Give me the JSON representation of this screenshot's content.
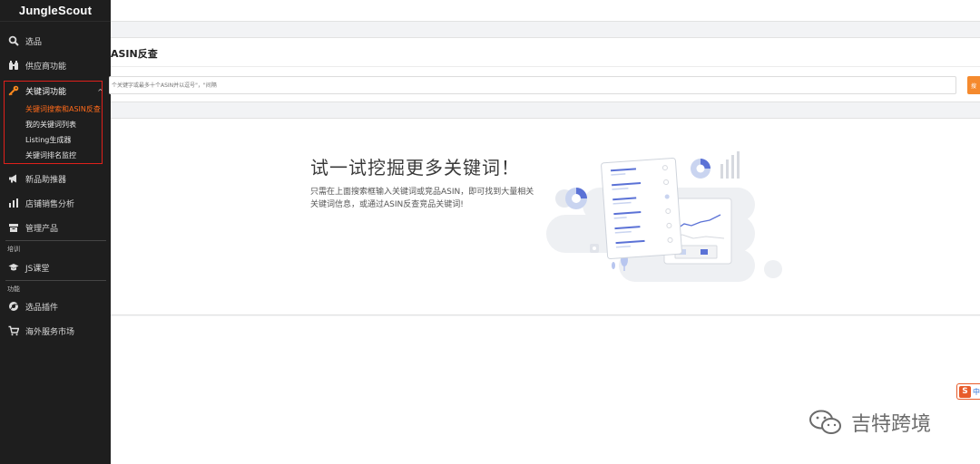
{
  "sidebar": {
    "brand": "JungleScout",
    "items": [
      {
        "label": "选品",
        "icon": "search-icon"
      },
      {
        "label": "供应商功能",
        "icon": "binoculars-icon"
      },
      {
        "label": "关键词功能",
        "icon": "key-icon"
      },
      {
        "label": "新品助推器",
        "icon": "megaphone-icon"
      },
      {
        "label": "店铺销售分析",
        "icon": "bar-chart-icon"
      },
      {
        "label": "管理产品",
        "icon": "box-icon"
      },
      {
        "label": "JS课堂",
        "icon": "graduation-cap-icon"
      },
      {
        "label": "选品插件",
        "icon": "chrome-icon"
      },
      {
        "label": "海外服务市场",
        "icon": "cart-icon"
      }
    ],
    "keyword_subitems": [
      "关键词搜索和ASIN反查",
      "我的关键词列表",
      "Listing生成器",
      "关键词排名监控"
    ],
    "sections": {
      "training": "培训",
      "features": "功能"
    },
    "expand_glyph": "^"
  },
  "search_panel": {
    "title": "ASIN反查",
    "placeholder": "个关键字或最多十个ASIN并以逗号\"，\"间隔",
    "button_label": "搜"
  },
  "empty_state": {
    "title": "试一试挖掘更多关键词！",
    "description": "只需在上面搜索框输入关键词或竞品ASIN，即可找到大量相关关键词信息，或通过ASIN反查竞品关键词!"
  },
  "floating": {
    "sogou_s": "S",
    "sogou_z": "中"
  },
  "watermark": {
    "text": "吉特跨境"
  },
  "colors": {
    "sidebar_bg": "#1e1e1e",
    "accent_orange": "#ff6a1a",
    "highlight_red": "#e0201b",
    "button_orange": "#f58a2e"
  }
}
